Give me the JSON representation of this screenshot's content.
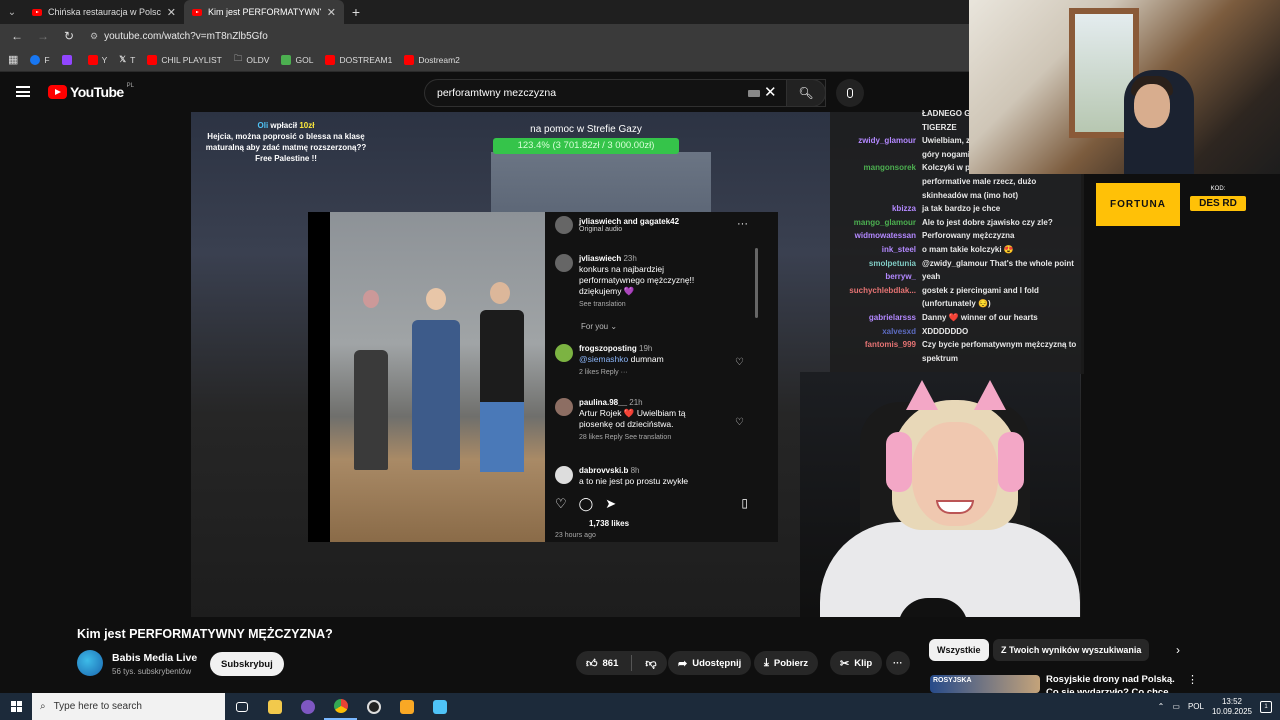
{
  "browser": {
    "tabs": [
      {
        "title": "Chińska restauracja w Polsce – A",
        "close": "✕"
      },
      {
        "title": "Kim jest PERFORMATYWNY",
        "close": "✕"
      }
    ],
    "new_tab": "+",
    "url": "youtube.com/watch?v=mT8nZlb5Gfo",
    "bookmarks": [
      "F",
      "",
      "Y",
      "T",
      "CHIL PLAYLIST",
      "OLDV",
      "GOL",
      "DOSTREAM1",
      "Dostream2"
    ]
  },
  "youtube": {
    "logo_text": "YouTube",
    "logo_country": "PL",
    "search_value": "perforamtwny mezczyzna"
  },
  "video_overlay": {
    "donor_name": "Oli",
    "donor_action": "wpłacił",
    "donor_amount": "10zł",
    "donor_message": "Hejcia, można poprosić o blessa na klasę maturalną aby zdać matmę rozszerzoną?? Free Palestine !!",
    "goal_title": "na pomoc w Strefie Gazy",
    "goal_text": "123.4% (3 701.82zł / 3 000.00zł)",
    "goal_percent": 1.234
  },
  "clip": {
    "header_title": "jvliaswiech and gagatek42",
    "header_sub": "Original audio",
    "more": "···",
    "caption_user": "jvliaswiech",
    "caption_time": "23h",
    "caption_text": "konkurs na najbardziej performatywnego mężczyznę!! dziękujemy 💜",
    "see_translation": "See translation",
    "for_you": "For you ⌄",
    "comments": [
      {
        "user": "frogszoposting",
        "time": "19h",
        "mention": "@siemashko",
        "text": "dumnam",
        "meta": "2 likes   Reply   ···"
      },
      {
        "user": "paulina.98__",
        "time": "21h",
        "text": "Artur Rojek ❤️ Uwielbiam tą piosenkę od dzieciństwa.",
        "meta": "28 likes   Reply   See translation"
      },
      {
        "user": "dabrovvski.b",
        "time": "8h",
        "text": "a to nie jest po prostu zwykłe"
      }
    ],
    "likes": "1,738 likes",
    "ago": "23 hours ago"
  },
  "chat": [
    {
      "user": "",
      "msg": "ŁADNEGO G",
      "color": "#e8e8e8"
    },
    {
      "user": "",
      "msg": "TIGERZE",
      "color": "#e8e8e8"
    },
    {
      "user": "zwidy_glamour",
      "msg": "Uwielbiam, za",
      "color": "#b388ff"
    },
    {
      "user": "",
      "msg": "góry nogami",
      "color": "#e8e8e8"
    },
    {
      "user": "mangonsorek",
      "msg": "Kolczyki w p",
      "color": "#4caf50"
    },
    {
      "user": "",
      "msg": "performative male rzecz, dużo",
      "color": "#e8e8e8"
    },
    {
      "user": "",
      "msg": "skinheadów ma (imo hot)",
      "color": "#e8e8e8"
    },
    {
      "user": "kbizza",
      "msg": "ja tak bardzo je chce",
      "color": "#b388ff"
    },
    {
      "user": "mango_glamour",
      "msg": "Ale to jest dobre zjawisko czy zle?",
      "color": "#4caf50"
    },
    {
      "user": "widmowatessan",
      "msg": "Perforowany mężczyzna",
      "color": "#b388ff"
    },
    {
      "user": "ink_steel",
      "msg": "o mam takie kolczyki 😍",
      "color": "#b388ff"
    },
    {
      "user": "smolpetunia",
      "msg": "@zwidy_glamour That's the whole point",
      "color": "#80cbc4"
    },
    {
      "user": "berryw_",
      "msg": "yeah",
      "color": "#b388ff"
    },
    {
      "user": "suchychlebdlak...",
      "msg": "gostek z piercingami and I fold",
      "color": "#e57373"
    },
    {
      "user": "",
      "msg": "(unfortunately 😔)",
      "color": "#e8e8e8"
    },
    {
      "user": "gabrielarsss",
      "msg": "Danny ❤️ winner of our hearts",
      "color": "#b388ff"
    },
    {
      "user": "xalvesxd",
      "msg": "XDDDDDDO",
      "color": "#5c6bc0"
    },
    {
      "user": "fantomis_999",
      "msg": "Czy bycie perfomatywnym mężczyzną to",
      "color": "#e57373"
    },
    {
      "user": "",
      "msg": "spektrum",
      "color": "#e8e8e8"
    }
  ],
  "sponsor": {
    "brand": "FORTUNA",
    "code_label": "KOD:",
    "code": "DES RD"
  },
  "video": {
    "title": "Kim jest PERFORMATYWNY MĘŻCZYZNA?",
    "channel": "Babis Media Live",
    "subs": "56 tys. subskrybentów",
    "subscribe": "Subskrybuj",
    "likes": "861",
    "share": "Udostępnij",
    "download": "Pobierz",
    "clip": "Klip",
    "more": "···"
  },
  "recommend": {
    "chips": [
      "Wszystkie",
      "Z Twoich wyników wyszukiwania"
    ],
    "thumb_label": "ROSYJSKA",
    "title": "Rosyjskie drony nad Polską. Co się wydarzyło? Co chce"
  },
  "taskbar": {
    "search_placeholder": "Type here to search",
    "lang": "POL",
    "time": "13:52",
    "date": "10.09.2025",
    "notif_count": "1"
  }
}
